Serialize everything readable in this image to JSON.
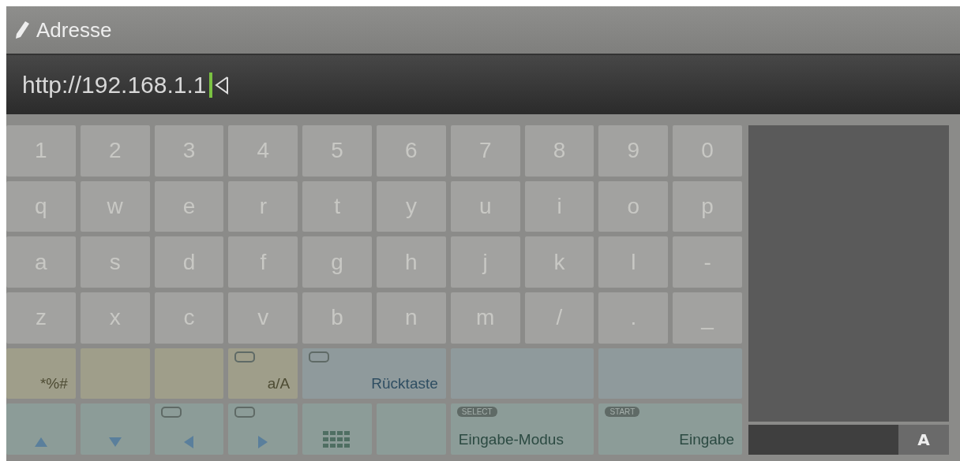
{
  "header": {
    "title": "Adresse"
  },
  "address": {
    "value": "http://192.168.1.1"
  },
  "keys": [
    [
      "1",
      "2",
      "3",
      "4",
      "5",
      "6",
      "7",
      "8",
      "9",
      "0"
    ],
    [
      "q",
      "w",
      "e",
      "r",
      "t",
      "y",
      "u",
      "i",
      "o",
      "p"
    ],
    [
      "a",
      "s",
      "d",
      "f",
      "g",
      "h",
      "j",
      "k",
      "l",
      "-"
    ],
    [
      "z",
      "x",
      "c",
      "v",
      "b",
      "n",
      "m",
      "/",
      ".",
      "_"
    ]
  ],
  "function_rows": [
    [
      {
        "kind": "text",
        "label": "*%#"
      },
      {
        "kind": "blank"
      },
      {
        "kind": "blank"
      },
      {
        "kind": "text",
        "label": "a/A",
        "hint": true
      },
      {
        "kind": "wide_text",
        "label": "Rücktaste",
        "hint": true
      },
      {
        "kind": "wide_blank"
      },
      {
        "kind": "wide_blank"
      }
    ],
    [
      {
        "kind": "up",
        "hint": false
      },
      {
        "kind": "down",
        "hint": false
      },
      {
        "kind": "left",
        "hint": true
      },
      {
        "kind": "right",
        "hint": true
      },
      {
        "kind": "grid"
      },
      {
        "kind": "blank"
      },
      {
        "kind": "wide_text",
        "label": "Eingabe-Modus",
        "badge_text": "SELECT"
      },
      {
        "kind": "wide_text",
        "label": "Eingabe",
        "badge_text": "START"
      }
    ]
  ],
  "side_panel": {
    "mode_key": "A"
  }
}
